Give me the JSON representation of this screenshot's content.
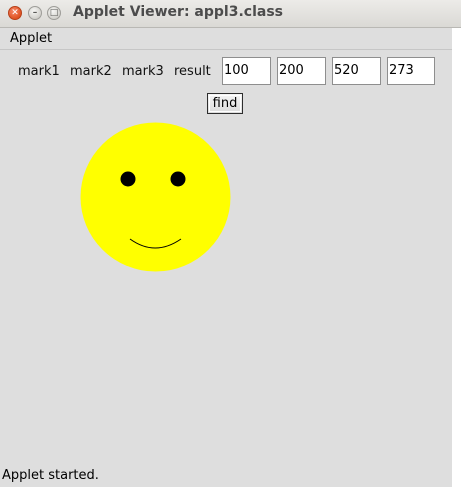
{
  "window": {
    "title": "Applet Viewer: appl3.class"
  },
  "menubar": {
    "items": [
      {
        "label": "Applet"
      }
    ]
  },
  "form": {
    "labels": [
      "mark1",
      "mark2",
      "mark3",
      "result"
    ],
    "fields": [
      {
        "name": "mark1",
        "value": "100"
      },
      {
        "name": "mark2",
        "value": "200"
      },
      {
        "name": "mark3",
        "value": "520"
      },
      {
        "name": "result",
        "value": "273"
      }
    ],
    "find_label": "find"
  },
  "drawing": {
    "face_color": "#ffff00",
    "eye_color": "#000000",
    "mouth_color": "#000000"
  },
  "status": {
    "text": "Applet started."
  },
  "colors": {
    "close_button": "#e05322",
    "background": "#dedede"
  }
}
